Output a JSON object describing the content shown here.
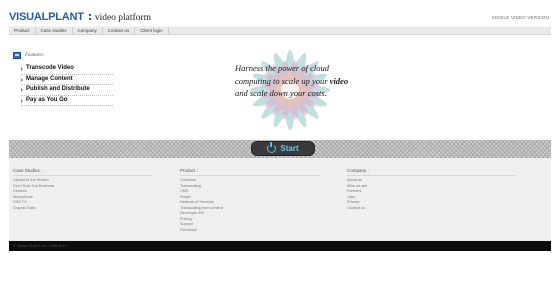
{
  "header": {
    "logo_part1": "VISUAL",
    "logo_part2": "PLANT",
    "logo_tagline": "video platform",
    "top_link": "SINGLE VIDEO VERSION"
  },
  "nav": {
    "items": [
      "Product",
      "Case studies",
      "Company",
      "Contact us",
      "Client login"
    ]
  },
  "hero": {
    "features_title": "Features:",
    "features": [
      "Transcode Video",
      "Manage Content",
      "Publish and Distribute",
      "Pay as You Go"
    ],
    "tagline_line1": "Harness the power of cloud",
    "tagline_line2_pre": "computing to scale up your ",
    "tagline_line2_bold": "video",
    "tagline_line3": "and scale down your costs.",
    "start_label": "Start"
  },
  "footer": {
    "columns": [
      {
        "title": "Case Studies :",
        "links": [
          "Upload to the Hidden",
          "Don't Rule Out Business",
          "Dinamix",
          "Microphone",
          "DSS TV",
          "Graphic Data"
        ]
      },
      {
        "title": "Product :",
        "links": [
          "Overview",
          "Transcoding",
          "CMS",
          "Player",
          "Network of Services",
          "Transcoding from content",
          "Developer API",
          "Pricing",
          "Support",
          "Feedback"
        ]
      },
      {
        "title": "Company :",
        "links": [
          "About us",
          "Who we are",
          "Partners",
          "Jobs",
          "Privacy",
          "Contact us"
        ]
      }
    ],
    "copyright": "© Visual PLANT Inc. 2008-2012"
  },
  "colors": {
    "brand_blue": "#1f5ea8",
    "start_text": "#6cc4f0",
    "bottom_bar": "#0c0c0c"
  }
}
